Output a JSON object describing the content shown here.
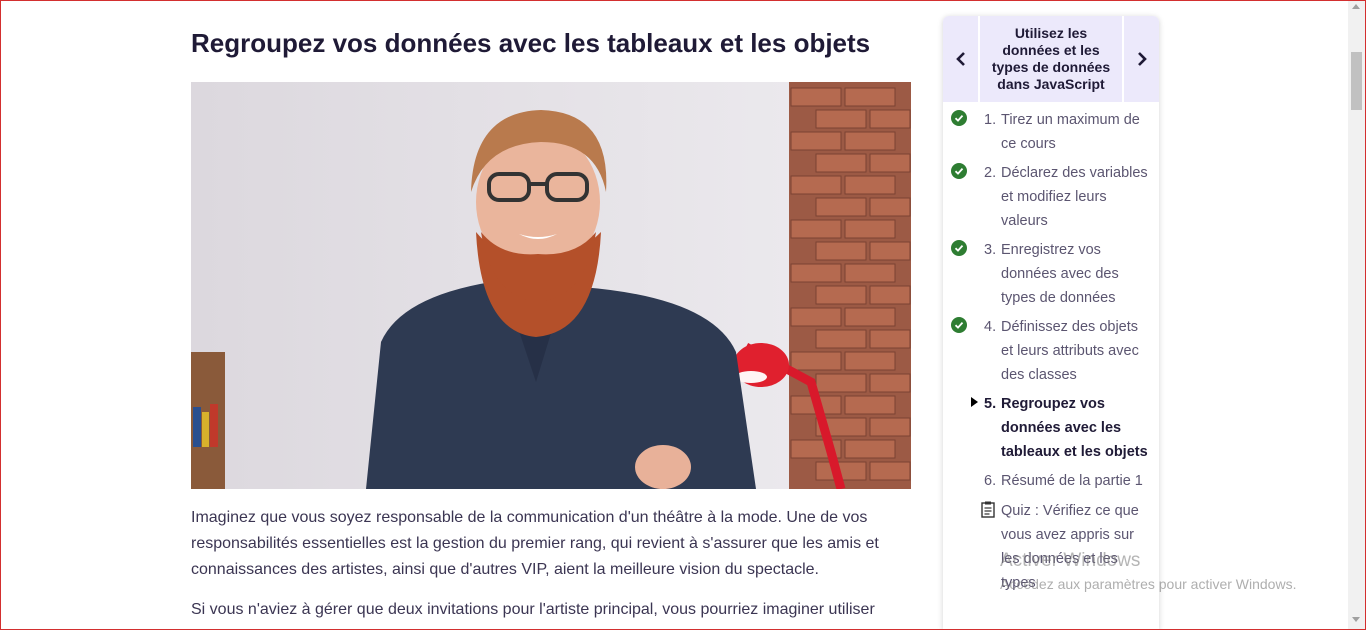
{
  "page": {
    "title": "Regroupez vos données avec les tableaux et les objets"
  },
  "video": {
    "icon": "video-player"
  },
  "content": {
    "paragraph1": "Imaginez que vous soyez responsable de la communication d'un théâtre à la mode. Une de vos responsabilités essentielles est la gestion du premier rang, qui revient à s'assurer que les amis et connaissances des artistes, ainsi que d'autres VIP, aient la meilleure vision du spectacle.",
    "paragraph2": "Si vous n'aviez à gérer que deux invitations pour l'artiste principal, vous pourriez imaginer utiliser"
  },
  "sidebar": {
    "prev_icon": "chevron-left-icon",
    "next_icon": "chevron-right-icon",
    "chapter_title": "Utilisez les données et les types de données dans JavaScript",
    "items": [
      {
        "num": "1.",
        "label": "Tirez un maximum de ce cours",
        "status": "done"
      },
      {
        "num": "2.",
        "label": "Déclarez des variables et modifiez leurs valeurs",
        "status": "done"
      },
      {
        "num": "3.",
        "label": "Enregistrez vos données avec des types de données",
        "status": "done"
      },
      {
        "num": "4.",
        "label": "Définissez des objets et leurs attributs avec des classes",
        "status": "done"
      },
      {
        "num": "5.",
        "label": "Regroupez vos données avec les tableaux et les objets",
        "status": "current"
      },
      {
        "num": "6.",
        "label": "Résumé de la partie 1",
        "status": "todo"
      },
      {
        "num": "",
        "label": "Quiz : Vérifiez ce que vous avez appris sur les données et les types",
        "status": "quiz"
      }
    ]
  },
  "watermark": {
    "line1": "Activer Windows",
    "line2": "Accédez aux paramètres pour activer Windows."
  },
  "colors": {
    "accent_light": "#ece9fb",
    "check_green": "#2e7d32",
    "text_dark": "#1f1a36"
  }
}
